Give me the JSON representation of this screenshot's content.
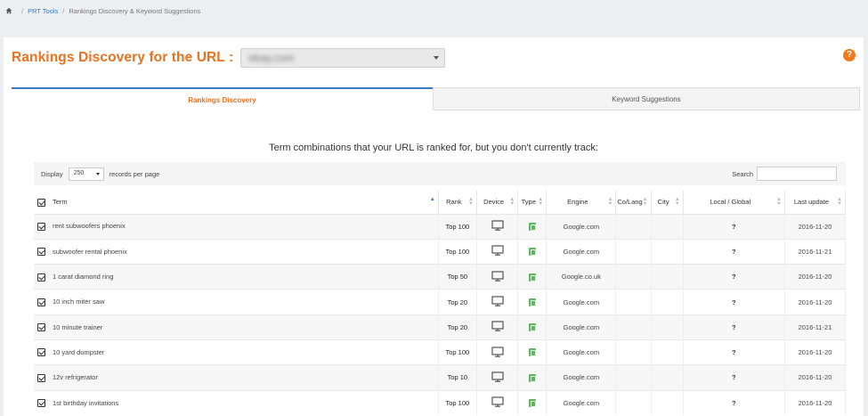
{
  "breadcrumb": {
    "item1": "PRT Tools",
    "item2": "Rankings Discovery & Keyword Suggestions"
  },
  "header": {
    "title": "Rankings Discovery for the URL :",
    "url_value": "ebay.com",
    "help": "?"
  },
  "tabs": {
    "active": "Rankings Discovery",
    "inactive": "Keyword Suggestions"
  },
  "intro": "Term combinations that your URL is ranked for, but you don't currently track:",
  "controls": {
    "display_label": "Display",
    "records_value": "250",
    "records_suffix": "records per page",
    "search_label": "Search"
  },
  "table": {
    "headers": {
      "term": "Term",
      "rank": "Rank",
      "device": "Device",
      "type": "Type",
      "engine": "Engine",
      "colang": "Co/Lang",
      "city": "City",
      "local_global": "Local / Global",
      "last_update": "Last update"
    },
    "rows": [
      {
        "term": "rent subwoofers phoenix",
        "rank": "Top 100",
        "engine": "Google.com",
        "local": "?",
        "date": "2016-11-20"
      },
      {
        "term": "subwoofer rental phoenix",
        "rank": "Top 100",
        "engine": "Google.com",
        "local": "?",
        "date": "2016-11-21"
      },
      {
        "term": "1 carat diamond ring",
        "rank": "Top 50",
        "engine": "Google.co.uk",
        "local": "?",
        "date": "2016-11-20"
      },
      {
        "term": "10 inch miter saw",
        "rank": "Top 20",
        "engine": "Google.com",
        "local": "?",
        "date": "2016-11-20"
      },
      {
        "term": "10 minute trainer",
        "rank": "Top 20",
        "engine": "Google.com",
        "local": "?",
        "date": "2016-11-21"
      },
      {
        "term": "10 yard dumpster",
        "rank": "Top 100",
        "engine": "Google.com",
        "local": "?",
        "date": "2016-11-20"
      },
      {
        "term": "12v refrigerator",
        "rank": "Top 10",
        "engine": "Google.com",
        "local": "?",
        "date": "2016-11-20"
      },
      {
        "term": "1st birthday invitations",
        "rank": "Top 100",
        "engine": "Google.com",
        "local": "?",
        "date": "2016-11-20"
      }
    ]
  },
  "colors": {
    "accent_orange": "#e8731f",
    "link_blue": "#3a7cc1",
    "type_green": "#5cb85c"
  },
  "icons": {
    "home": "home-icon",
    "help": "question-circle-icon",
    "device": "desktop-monitor-icon",
    "type": "desktop-type-icon"
  }
}
